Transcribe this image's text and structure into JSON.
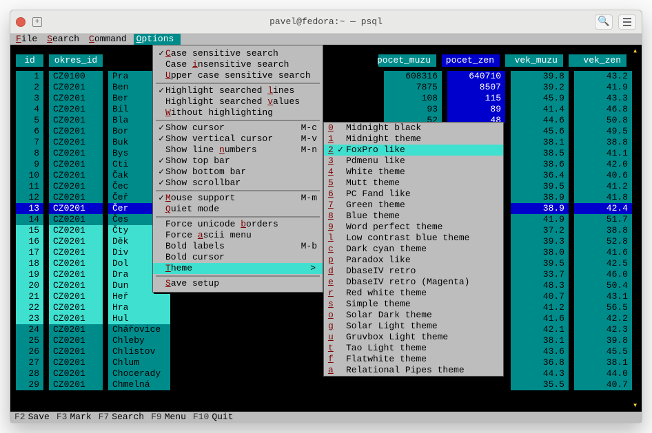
{
  "window": {
    "title": "pavel@fedora:~ — psql"
  },
  "menubar": {
    "items": [
      {
        "label": "File",
        "hot": "F"
      },
      {
        "label": "Search",
        "hot": "S"
      },
      {
        "label": "Command",
        "hot": "C"
      },
      {
        "label": "Options",
        "hot": "O",
        "active": true
      }
    ]
  },
  "columns": {
    "left": [
      {
        "key": "id",
        "label": "id"
      },
      {
        "key": "okres",
        "label": "okres_id"
      }
    ],
    "right": [
      {
        "key": "pmuzu",
        "label": "pocet_muzu"
      },
      {
        "key": "pzen",
        "label": "pocet_zen",
        "selected": true
      },
      {
        "key": "vmuzu",
        "label": "vek_muzu"
      },
      {
        "key": "vzen",
        "label": "vek_zen"
      }
    ]
  },
  "rows": [
    {
      "id": "1",
      "ok": "CZ0100",
      "nm": "Pra",
      "r": [
        "608316",
        "640710",
        "39.8",
        "43.2"
      ]
    },
    {
      "id": "2",
      "ok": "CZ0201",
      "nm": "Ben",
      "r": [
        "7875",
        "8507",
        "39.2",
        "41.9"
      ]
    },
    {
      "id": "3",
      "ok": "CZ0201",
      "nm": "Ber",
      "r": [
        "108",
        "115",
        "45.9",
        "43.3"
      ]
    },
    {
      "id": "4",
      "ok": "CZ0201",
      "nm": "Bíl",
      "r": [
        "93",
        "89",
        "41.4",
        "46.8"
      ]
    },
    {
      "id": "5",
      "ok": "CZ0201",
      "nm": "Bla",
      "r": [
        "52",
        "48",
        "44.6",
        "50.8"
      ]
    },
    {
      "id": "6",
      "ok": "CZ0201",
      "nm": "Bor",
      "r": [
        "",
        "",
        "45.6",
        "49.5"
      ]
    },
    {
      "id": "7",
      "ok": "CZ0201",
      "nm": "Buk",
      "r": [
        "",
        "",
        "38.1",
        "38.8"
      ]
    },
    {
      "id": "8",
      "ok": "CZ0201",
      "nm": "Bys",
      "r": [
        "",
        "",
        "38.5",
        "41.1"
      ]
    },
    {
      "id": "9",
      "ok": "CZ0201",
      "nm": "Cti",
      "r": [
        "",
        "",
        "38.6",
        "42.0"
      ]
    },
    {
      "id": "10",
      "ok": "CZ0201",
      "nm": "Čak",
      "r": [
        "",
        "",
        "36.4",
        "40.6"
      ]
    },
    {
      "id": "11",
      "ok": "CZ0201",
      "nm": "Čec",
      "r": [
        "",
        "",
        "39.5",
        "41.2"
      ]
    },
    {
      "id": "12",
      "ok": "CZ0201",
      "nm": "Čeř",
      "r": [
        "",
        "",
        "38.9",
        "41.8"
      ]
    },
    {
      "id": "13",
      "ok": "CZ0201",
      "nm": "Čer",
      "hl": true,
      "r": [
        "",
        "",
        "38.9",
        "42.4"
      ]
    },
    {
      "id": "14",
      "ok": "CZ0201",
      "nm": "Čes",
      "r": [
        "",
        "",
        "41.9",
        "51.7"
      ]
    },
    {
      "id": "15",
      "ok": "CZ0201",
      "nm": "Čty",
      "hit": true,
      "r": [
        "",
        "",
        "37.2",
        "38.8"
      ]
    },
    {
      "id": "16",
      "ok": "CZ0201",
      "nm": "Děk",
      "hit": true,
      "r": [
        "",
        "",
        "39.3",
        "52.8"
      ]
    },
    {
      "id": "17",
      "ok": "CZ0201",
      "nm": "Div",
      "hit": true,
      "r": [
        "",
        "",
        "38.0",
        "41.6"
      ]
    },
    {
      "id": "18",
      "ok": "CZ0201",
      "nm": "Dol",
      "hit": true,
      "r": [
        "",
        "",
        "39.5",
        "42.5"
      ]
    },
    {
      "id": "19",
      "ok": "CZ0201",
      "nm": "Dra",
      "hit": true,
      "r": [
        "",
        "",
        "33.7",
        "46.0"
      ]
    },
    {
      "id": "20",
      "ok": "CZ0201",
      "nm": "Dun",
      "hit": true,
      "r": [
        "",
        "",
        "48.3",
        "50.4"
      ]
    },
    {
      "id": "21",
      "ok": "CZ0201",
      "nm": "Heř",
      "hit": true,
      "r": [
        "",
        "",
        "40.7",
        "43.1"
      ]
    },
    {
      "id": "22",
      "ok": "CZ0201",
      "nm": "Hra",
      "hit": true,
      "r": [
        "",
        "",
        "41.2",
        "56.5"
      ]
    },
    {
      "id": "23",
      "ok": "CZ0201",
      "nm": "Hul",
      "hit": true,
      "r": [
        "",
        "",
        "41.6",
        "42.2"
      ]
    },
    {
      "id": "24",
      "ok": "CZ0201",
      "nm": "Chářovice",
      "r": [
        "",
        "",
        "42.1",
        "42.3"
      ]
    },
    {
      "id": "25",
      "ok": "CZ0201",
      "nm": "Chleby",
      "r": [
        "",
        "",
        "38.1",
        "39.8"
      ]
    },
    {
      "id": "26",
      "ok": "CZ0201",
      "nm": "Chlístov",
      "r": [
        "",
        "",
        "43.6",
        "45.5"
      ]
    },
    {
      "id": "27",
      "ok": "CZ0201",
      "nm": "Chlum",
      "r": [
        "",
        "",
        "36.8",
        "38.1"
      ]
    },
    {
      "id": "28",
      "ok": "CZ0201",
      "nm": "Chocerady",
      "r": [
        "",
        "",
        "44.3",
        "44.0"
      ]
    },
    {
      "id": "29",
      "ok": "CZ0201",
      "nm": "Chmelná",
      "r": [
        "",
        "",
        "35.5",
        "40.7"
      ]
    }
  ],
  "options_menu": {
    "groups": [
      [
        {
          "ck": true,
          "hot": "C",
          "label": "ase sensitive search"
        },
        {
          "ck": false,
          "hot": "i",
          "prefix": "Case ",
          "label": "nsensitive search"
        },
        {
          "ck": false,
          "hot": "U",
          "label": "pper case sensitive search"
        }
      ],
      [
        {
          "ck": true,
          "hot": "l",
          "prefix": "Highlight searched ",
          "label": "ines"
        },
        {
          "ck": false,
          "hot": "v",
          "prefix": "Highlight searched ",
          "label": "alues"
        },
        {
          "ck": false,
          "hot": "W",
          "label": "ithout highlighting"
        }
      ],
      [
        {
          "ck": true,
          "label": "Show cursor",
          "kb": "M-c"
        },
        {
          "ck": true,
          "label": "Show vertical cursor",
          "kb": "M-v"
        },
        {
          "ck": false,
          "hot": "n",
          "prefix": "Show line ",
          "label": "umbers",
          "kb": "M-n"
        },
        {
          "ck": true,
          "label": "Show top bar"
        },
        {
          "ck": true,
          "label": "Show bottom bar"
        },
        {
          "ck": true,
          "label": "Show scrollbar"
        }
      ],
      [
        {
          "ck": true,
          "hot": "M",
          "label": "ouse support",
          "kb": "M-m"
        },
        {
          "ck": false,
          "hot": "Q",
          "label": "uiet mode"
        }
      ],
      [
        {
          "ck": false,
          "hot": "b",
          "prefix": "Force unicode ",
          "label": "orders"
        },
        {
          "ck": false,
          "hot": "a",
          "prefix": "Force ",
          "label": "scii menu"
        },
        {
          "ck": false,
          "label": "Bold labels",
          "kb": "M-b"
        },
        {
          "ck": false,
          "label": "Bold cursor"
        },
        {
          "ck": false,
          "hot": "T",
          "label": "heme",
          "sub": true,
          "sel": true
        }
      ],
      [
        {
          "ck": false,
          "hot": "S",
          "label": "ave setup"
        }
      ]
    ]
  },
  "theme_menu": {
    "items": [
      {
        "key": "0",
        "ck": false,
        "label": "Midnight black"
      },
      {
        "key": "1",
        "ck": false,
        "label": "Midnight theme"
      },
      {
        "key": "2",
        "ck": true,
        "label": "FoxPro like",
        "sel": true
      },
      {
        "key": "3",
        "ck": false,
        "label": "Pdmenu like"
      },
      {
        "key": "4",
        "ck": false,
        "label": "White theme"
      },
      {
        "key": "5",
        "ck": false,
        "label": "Mutt theme"
      },
      {
        "key": "6",
        "ck": false,
        "label": "PC Fand like"
      },
      {
        "key": "7",
        "ck": false,
        "label": "Green theme"
      },
      {
        "key": "8",
        "ck": false,
        "label": "Blue theme"
      },
      {
        "key": "9",
        "ck": false,
        "label": "Word perfect theme"
      },
      {
        "key": "l",
        "ck": false,
        "label": "Low contrast blue theme"
      },
      {
        "key": "c",
        "ck": false,
        "label": "Dark cyan theme"
      },
      {
        "key": "p",
        "ck": false,
        "label": "Paradox like"
      },
      {
        "key": "d",
        "ck": false,
        "label": "DbaseIV retro"
      },
      {
        "key": "e",
        "ck": false,
        "label": "DbaseIV retro (Magenta)"
      },
      {
        "key": "r",
        "ck": false,
        "label": "Red white theme"
      },
      {
        "key": "s",
        "ck": false,
        "label": "Simple theme"
      },
      {
        "key": "o",
        "ck": false,
        "label": "Solar Dark theme"
      },
      {
        "key": "g",
        "ck": false,
        "label": "Solar Light theme"
      },
      {
        "key": "u",
        "ck": false,
        "label": "Gruvbox Light theme"
      },
      {
        "key": "t",
        "ck": false,
        "label": "Tao Light theme"
      },
      {
        "key": "f",
        "ck": false,
        "label": "Flatwhite theme"
      },
      {
        "key": "a",
        "ck": false,
        "label": "Relational Pipes theme"
      }
    ]
  },
  "footer": [
    {
      "key": "F2",
      "label": "Save"
    },
    {
      "key": "F3",
      "label": "Mark"
    },
    {
      "key": "F7",
      "label": "Search"
    },
    {
      "key": "F9",
      "label": "Menu"
    },
    {
      "key": "F10",
      "label": "Quit"
    }
  ],
  "scroll": {
    "up": "▴",
    "down": "▾"
  }
}
